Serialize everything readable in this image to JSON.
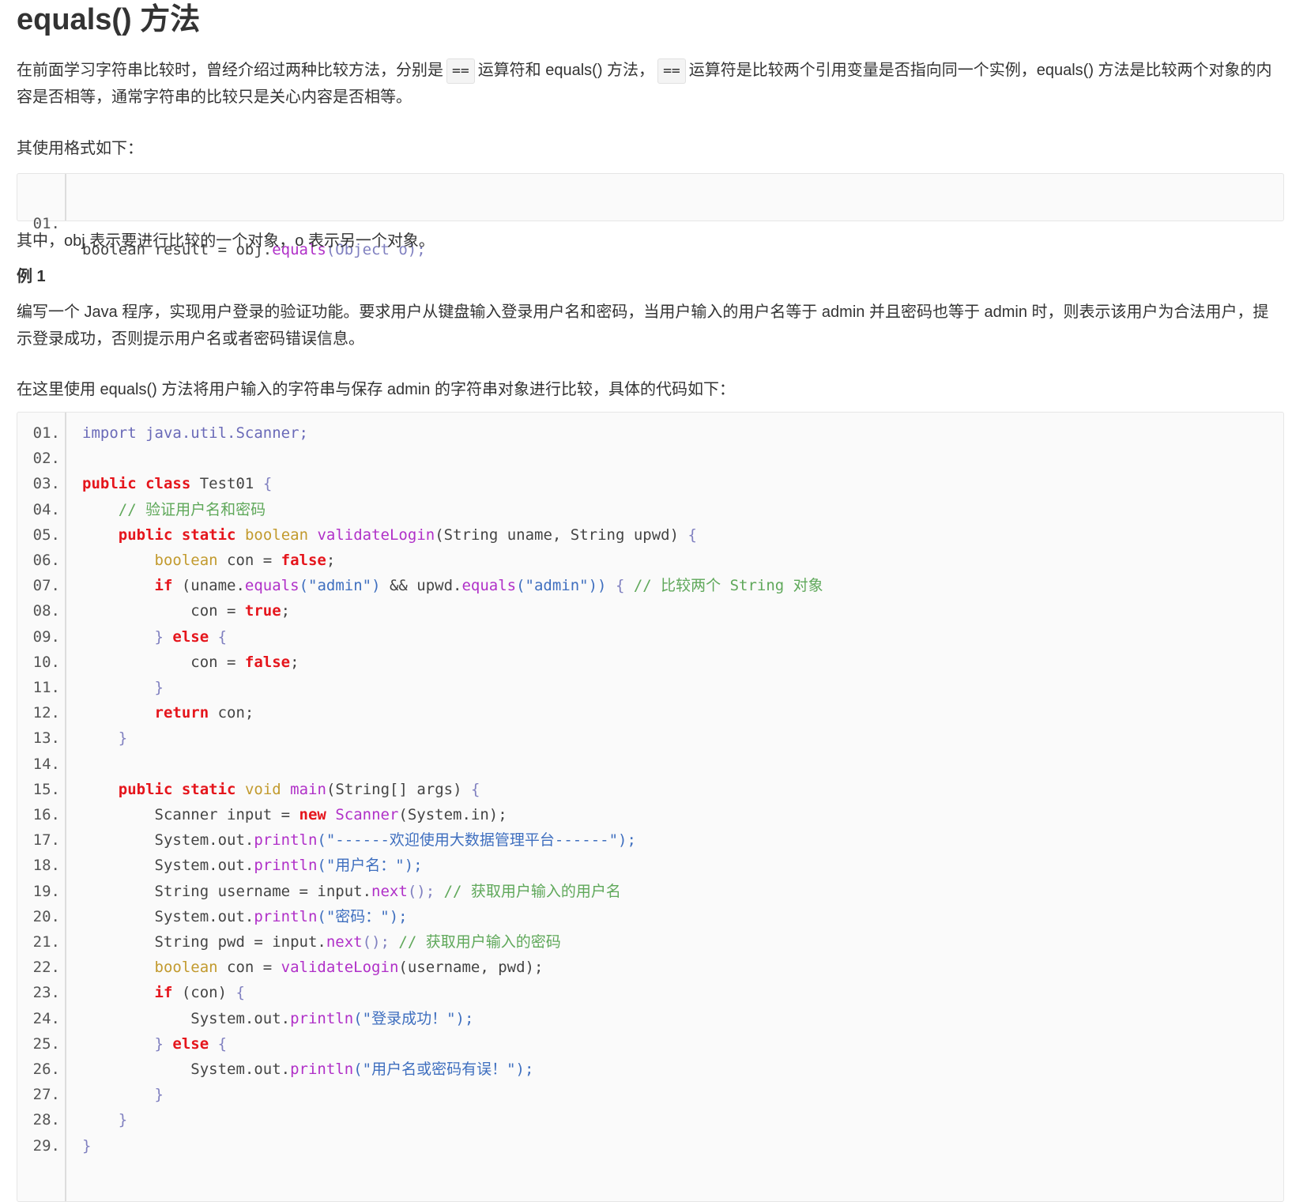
{
  "title": "equals() 方法",
  "intro": {
    "p1_a": "在前面学习字符串比较时，曾经介绍过两种比较方法，分别是",
    "op1": "==",
    "p1_b": "运算符和 equals() 方法，",
    "op2": "==",
    "p1_c": "运算符是比较两个引用变量是否指向同一个实例，equals() 方法是比较两个对象的内容是否相等，通常字符串的比较只是关心内容是否相等。"
  },
  "format_label": "其使用格式如下：",
  "snippet": {
    "line_no": "01.",
    "parts": [
      {
        "t": "boolean result = obj.",
        "c": "pl"
      },
      {
        "t": "equals",
        "c": "fn"
      },
      {
        "t": "(Object o);",
        "c": "pn"
      }
    ]
  },
  "explain": "其中，obj 表示要进行比较的一个对象，o 表示另一个对象。",
  "example_heading": "例 1",
  "example_desc": "编写一个 Java 程序，实现用户登录的验证功能。要求用户从键盘输入登录用户名和密码，当用户输入的用户名等于 admin 并且密码也等于 admin 时，则表示该用户为合法用户，提示登录成功，否则提示用户名或者密码错误信息。",
  "code_intro": "在这里使用 equals() 方法将用户输入的字符串与保存 admin 的字符串对象进行比较，具体的代码如下：",
  "code_lines": [
    {
      "n": "01.",
      "parts": [
        {
          "t": "import java.util.Scanner;",
          "c": "im"
        }
      ]
    },
    {
      "n": "02.",
      "parts": []
    },
    {
      "n": "03.",
      "parts": [
        {
          "t": "public",
          "c": "kw"
        },
        {
          "t": " ",
          "c": "pl"
        },
        {
          "t": "class",
          "c": "kw"
        },
        {
          "t": " Test01 ",
          "c": "pl"
        },
        {
          "t": "{",
          "c": "pn"
        }
      ]
    },
    {
      "n": "04.",
      "parts": [
        {
          "t": "    // 验证用户名和密码",
          "c": "cm"
        }
      ]
    },
    {
      "n": "05.",
      "parts": [
        {
          "t": "    ",
          "c": "pl"
        },
        {
          "t": "public",
          "c": "kw"
        },
        {
          "t": " ",
          "c": "pl"
        },
        {
          "t": "static",
          "c": "kw"
        },
        {
          "t": " ",
          "c": "pl"
        },
        {
          "t": "boolean",
          "c": "ty"
        },
        {
          "t": " ",
          "c": "pl"
        },
        {
          "t": "validateLogin",
          "c": "fn"
        },
        {
          "t": "(String uname, String upwd) ",
          "c": "pl"
        },
        {
          "t": "{",
          "c": "pn"
        }
      ]
    },
    {
      "n": "06.",
      "parts": [
        {
          "t": "        ",
          "c": "pl"
        },
        {
          "t": "boolean",
          "c": "ty"
        },
        {
          "t": " con = ",
          "c": "pl"
        },
        {
          "t": "false",
          "c": "kw"
        },
        {
          "t": ";",
          "c": "pl"
        }
      ]
    },
    {
      "n": "07.",
      "parts": [
        {
          "t": "        ",
          "c": "pl"
        },
        {
          "t": "if",
          "c": "kw"
        },
        {
          "t": " (uname.",
          "c": "pl"
        },
        {
          "t": "equals",
          "c": "fn"
        },
        {
          "t": "(\"admin\")",
          "c": "st"
        },
        {
          "t": " && upwd.",
          "c": "pl"
        },
        {
          "t": "equals",
          "c": "fn"
        },
        {
          "t": "(\"admin\"))",
          "c": "st"
        },
        {
          "t": " { ",
          "c": "pn"
        },
        {
          "t": "// 比较两个 String 对象",
          "c": "cm"
        }
      ]
    },
    {
      "n": "08.",
      "parts": [
        {
          "t": "            con = ",
          "c": "pl"
        },
        {
          "t": "true",
          "c": "kw"
        },
        {
          "t": ";",
          "c": "pl"
        }
      ]
    },
    {
      "n": "09.",
      "parts": [
        {
          "t": "        ",
          "c": "pl"
        },
        {
          "t": "}",
          "c": "pn"
        },
        {
          "t": " ",
          "c": "pl"
        },
        {
          "t": "else",
          "c": "kw"
        },
        {
          "t": " ",
          "c": "pl"
        },
        {
          "t": "{",
          "c": "pn"
        }
      ]
    },
    {
      "n": "10.",
      "parts": [
        {
          "t": "            con = ",
          "c": "pl"
        },
        {
          "t": "false",
          "c": "kw"
        },
        {
          "t": ";",
          "c": "pl"
        }
      ]
    },
    {
      "n": "11.",
      "parts": [
        {
          "t": "        ",
          "c": "pl"
        },
        {
          "t": "}",
          "c": "pn"
        }
      ]
    },
    {
      "n": "12.",
      "parts": [
        {
          "t": "        ",
          "c": "pl"
        },
        {
          "t": "return",
          "c": "kw"
        },
        {
          "t": " con;",
          "c": "pl"
        }
      ]
    },
    {
      "n": "13.",
      "parts": [
        {
          "t": "    ",
          "c": "pl"
        },
        {
          "t": "}",
          "c": "pn"
        }
      ]
    },
    {
      "n": "14.",
      "parts": []
    },
    {
      "n": "15.",
      "parts": [
        {
          "t": "    ",
          "c": "pl"
        },
        {
          "t": "public",
          "c": "kw"
        },
        {
          "t": " ",
          "c": "pl"
        },
        {
          "t": "static",
          "c": "kw"
        },
        {
          "t": " ",
          "c": "pl"
        },
        {
          "t": "void",
          "c": "ty"
        },
        {
          "t": " ",
          "c": "pl"
        },
        {
          "t": "main",
          "c": "fn"
        },
        {
          "t": "(String[] args) ",
          "c": "pl"
        },
        {
          "t": "{",
          "c": "pn"
        }
      ]
    },
    {
      "n": "16.",
      "parts": [
        {
          "t": "        Scanner input = ",
          "c": "pl"
        },
        {
          "t": "new",
          "c": "kw"
        },
        {
          "t": " ",
          "c": "pl"
        },
        {
          "t": "Scanner",
          "c": "fn"
        },
        {
          "t": "(System.in);",
          "c": "pl"
        }
      ]
    },
    {
      "n": "17.",
      "parts": [
        {
          "t": "        System.out.",
          "c": "pl"
        },
        {
          "t": "println",
          "c": "fn"
        },
        {
          "t": "(\"------欢迎使用大数据管理平台------\");",
          "c": "st"
        }
      ]
    },
    {
      "n": "18.",
      "parts": [
        {
          "t": "        System.out.",
          "c": "pl"
        },
        {
          "t": "println",
          "c": "fn"
        },
        {
          "t": "(\"用户名：\");",
          "c": "st"
        }
      ]
    },
    {
      "n": "19.",
      "parts": [
        {
          "t": "        String username = input.",
          "c": "pl"
        },
        {
          "t": "next",
          "c": "fn"
        },
        {
          "t": "(); ",
          "c": "pn"
        },
        {
          "t": "// 获取用户输入的用户名",
          "c": "cm"
        }
      ]
    },
    {
      "n": "20.",
      "parts": [
        {
          "t": "        System.out.",
          "c": "pl"
        },
        {
          "t": "println",
          "c": "fn"
        },
        {
          "t": "(\"密码：\");",
          "c": "st"
        }
      ]
    },
    {
      "n": "21.",
      "parts": [
        {
          "t": "        String pwd = input.",
          "c": "pl"
        },
        {
          "t": "next",
          "c": "fn"
        },
        {
          "t": "(); ",
          "c": "pn"
        },
        {
          "t": "// 获取用户输入的密码",
          "c": "cm"
        }
      ]
    },
    {
      "n": "22.",
      "parts": [
        {
          "t": "        ",
          "c": "pl"
        },
        {
          "t": "boolean",
          "c": "ty"
        },
        {
          "t": " con = ",
          "c": "pl"
        },
        {
          "t": "validateLogin",
          "c": "fn"
        },
        {
          "t": "(username, pwd);",
          "c": "pl"
        }
      ]
    },
    {
      "n": "23.",
      "parts": [
        {
          "t": "        ",
          "c": "pl"
        },
        {
          "t": "if",
          "c": "kw"
        },
        {
          "t": " (con) ",
          "c": "pl"
        },
        {
          "t": "{",
          "c": "pn"
        }
      ]
    },
    {
      "n": "24.",
      "parts": [
        {
          "t": "            System.out.",
          "c": "pl"
        },
        {
          "t": "println",
          "c": "fn"
        },
        {
          "t": "(\"登录成功！\");",
          "c": "st"
        }
      ]
    },
    {
      "n": "25.",
      "parts": [
        {
          "t": "        ",
          "c": "pl"
        },
        {
          "t": "}",
          "c": "pn"
        },
        {
          "t": " ",
          "c": "pl"
        },
        {
          "t": "else",
          "c": "kw"
        },
        {
          "t": " ",
          "c": "pl"
        },
        {
          "t": "{",
          "c": "pn"
        }
      ]
    },
    {
      "n": "26.",
      "parts": [
        {
          "t": "            System.out.",
          "c": "pl"
        },
        {
          "t": "println",
          "c": "fn"
        },
        {
          "t": "(\"用户名或密码有误！\");",
          "c": "st"
        }
      ]
    },
    {
      "n": "27.",
      "parts": [
        {
          "t": "        ",
          "c": "pl"
        },
        {
          "t": "}",
          "c": "pn"
        }
      ]
    },
    {
      "n": "28.",
      "parts": [
        {
          "t": "    ",
          "c": "pl"
        },
        {
          "t": "}",
          "c": "pn"
        }
      ]
    },
    {
      "n": "29.",
      "parts": [
        {
          "t": "}",
          "c": "pn"
        }
      ]
    }
  ],
  "colors": {
    "keyword": "#e5151c",
    "type": "#c29a2e",
    "function": "#b030c8",
    "comment": "#5fa85a",
    "string": "#3f6fbf",
    "code_bg": "#fafafa"
  }
}
